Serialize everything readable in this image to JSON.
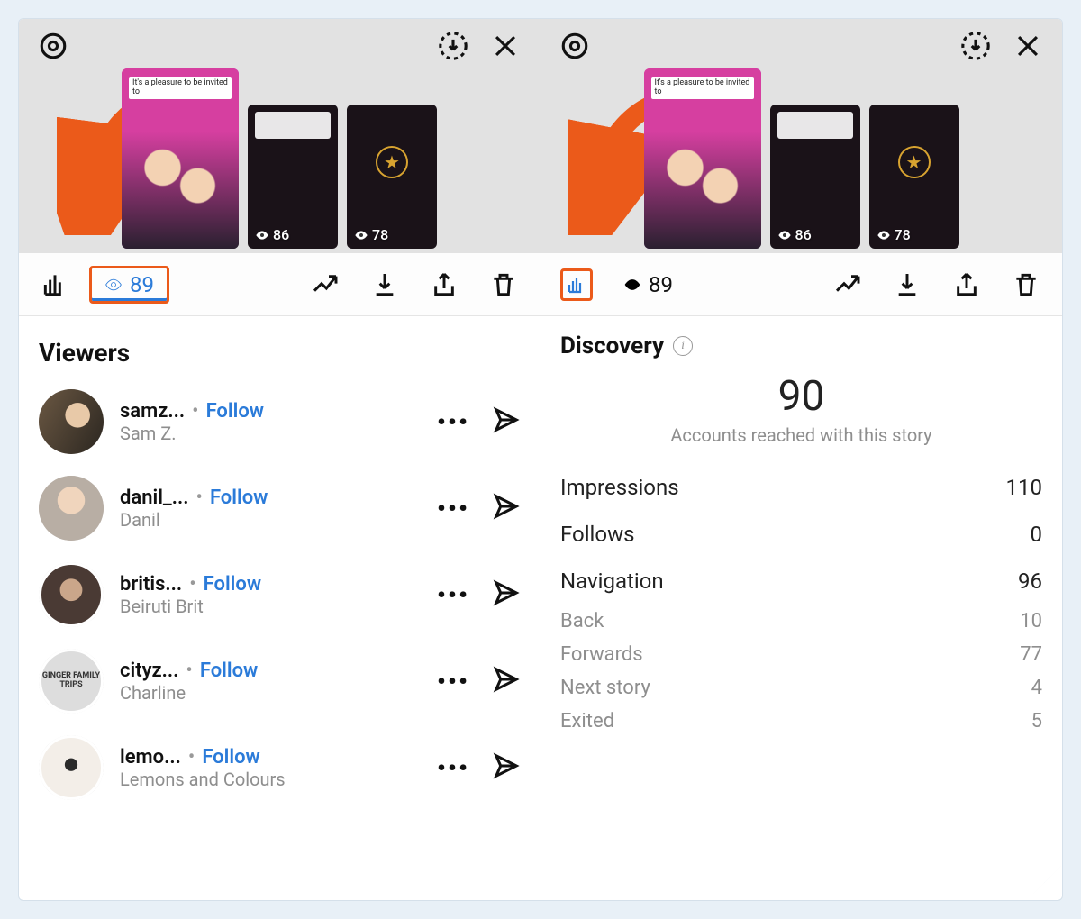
{
  "storyBar": {
    "stories": [
      {
        "caption": "It's a pleasure to be invited to",
        "views": "89"
      },
      {
        "views": "86"
      },
      {
        "views": "78"
      }
    ]
  },
  "actionBar": {
    "viewCount": "89"
  },
  "leftPane": {
    "title": "Viewers",
    "followLabel": "Follow",
    "viewers": [
      {
        "username": "samz...",
        "displayName": "Sam Z."
      },
      {
        "username": "danil_...",
        "displayName": "Danil"
      },
      {
        "username": "britis...",
        "displayName": "Beiruti Brit"
      },
      {
        "username": "cityz...",
        "displayName": "Charline",
        "ringText": "GINGER FAMILY TRIPS"
      },
      {
        "username": "lemo...",
        "displayName": "Lemons and Colours"
      }
    ]
  },
  "rightPane": {
    "title": "Discovery",
    "reach": "90",
    "reachCaption": "Accounts reached with this story",
    "stats": [
      {
        "label": "Impressions",
        "value": "110"
      },
      {
        "label": "Follows",
        "value": "0"
      },
      {
        "label": "Navigation",
        "value": "96"
      }
    ],
    "navBreakdown": [
      {
        "label": "Back",
        "value": "10"
      },
      {
        "label": "Forwards",
        "value": "77"
      },
      {
        "label": "Next story",
        "value": "4"
      },
      {
        "label": "Exited",
        "value": "5"
      }
    ]
  }
}
